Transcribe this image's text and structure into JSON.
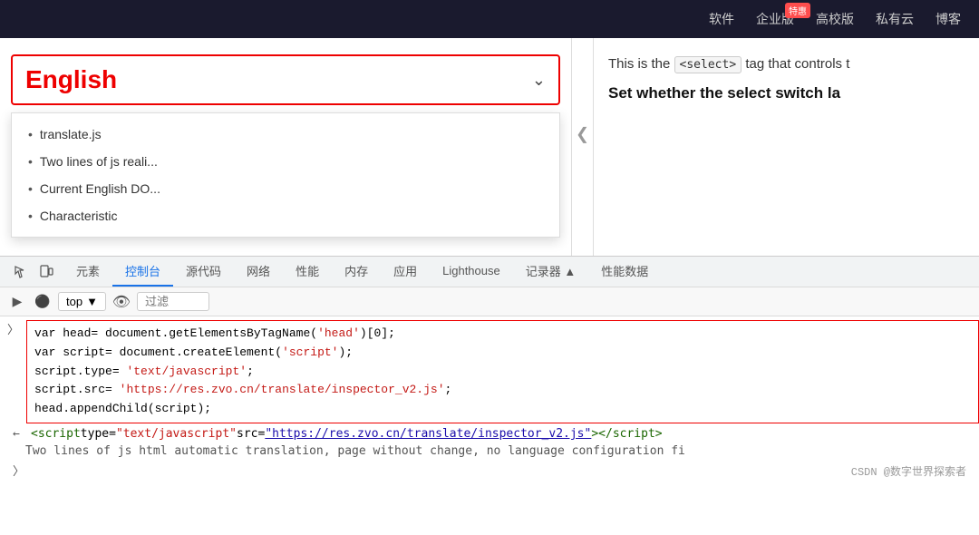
{
  "nav": {
    "items": [
      {
        "label": "软件",
        "key": "software"
      },
      {
        "label": "企业版",
        "key": "enterprise",
        "badge": "特惠"
      },
      {
        "label": "高校版",
        "key": "campus"
      },
      {
        "label": "私有云",
        "key": "private-cloud"
      },
      {
        "label": "博客",
        "key": "blog"
      }
    ]
  },
  "webpage": {
    "select_value": "English",
    "dropdown_items": [
      {
        "text": "translate.js"
      },
      {
        "text": "Two lines of js reali..."
      },
      {
        "text": "Current English DO..."
      },
      {
        "text": "Characteristic"
      }
    ],
    "right_text_1_before": "This is the ",
    "right_text_1_code": "<select>",
    "right_text_1_after": " tag that controls t",
    "right_text_2": "Set whether the select switch la"
  },
  "devtools": {
    "tabs": [
      {
        "label": "元素",
        "icon": "◻",
        "active": false
      },
      {
        "label": "控制台",
        "icon": "",
        "active": true
      },
      {
        "label": "源代码",
        "icon": "",
        "active": false
      },
      {
        "label": "网络",
        "icon": "",
        "active": false
      },
      {
        "label": "性能",
        "icon": "",
        "active": false
      },
      {
        "label": "内存",
        "icon": "",
        "active": false
      },
      {
        "label": "应用",
        "icon": "",
        "active": false
      },
      {
        "label": "Lighthouse",
        "icon": "",
        "active": false
      },
      {
        "label": "记录器 ▲",
        "icon": "",
        "active": false
      },
      {
        "label": "性能数据",
        "icon": "",
        "active": false
      }
    ],
    "toolbar": {
      "top_label": "top",
      "filter_placeholder": "过滤"
    },
    "code_lines": [
      {
        "parts": [
          {
            "text": "var head= document.getElementsByTagName(",
            "class": "code-normal"
          },
          {
            "text": "'head'",
            "class": "code-str"
          },
          {
            "text": ")[0];",
            "class": "code-normal"
          }
        ]
      },
      {
        "parts": [
          {
            "text": "var script= document.createElement(",
            "class": "code-normal"
          },
          {
            "text": "'script'",
            "class": "code-str"
          },
          {
            "text": ");",
            "class": "code-normal"
          }
        ]
      },
      {
        "parts": [
          {
            "text": "script.type= ",
            "class": "code-normal"
          },
          {
            "text": "'text/javascript'",
            "class": "code-str"
          },
          {
            "text": ";",
            "class": "code-normal"
          }
        ]
      },
      {
        "parts": [
          {
            "text": "script.src= ",
            "class": "code-normal"
          },
          {
            "text": "'https://res.zvo.cn/translate/inspector_v2.js'",
            "class": "code-str"
          },
          {
            "text": ";",
            "class": "code-normal"
          }
        ]
      },
      {
        "parts": [
          {
            "text": "head.appendChild(script);",
            "class": "code-normal"
          }
        ]
      }
    ],
    "script_tag_line": "<script type=\"text/javascript\" src=\"https://res.zvo.cn/translate/inspector_v2.js\"><\\/script>",
    "info_line": "Two lines of js html automatic translation, page without change, no language configuration fi",
    "footer_attr": "CSDN @数字世界探索者"
  }
}
